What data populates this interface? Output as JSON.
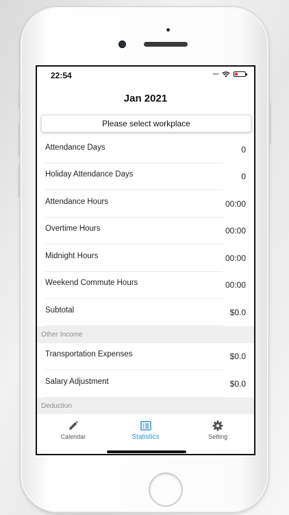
{
  "status_bar": {
    "time": "22:54"
  },
  "header": {
    "title": "Jan 2021"
  },
  "workplace_picker": {
    "label": "Please select workplace"
  },
  "summary": [
    {
      "label": "Attendance Days",
      "value": "0"
    },
    {
      "label": "Holiday Attendance Days",
      "value": "0"
    },
    {
      "label": "Attendance Hours",
      "value": "00:00"
    },
    {
      "label": "Overtime Hours",
      "value": "00:00"
    },
    {
      "label": "Midnight Hours",
      "value": "00:00"
    },
    {
      "label": "Weekend Commute Hours",
      "value": "00:00"
    },
    {
      "label": "Subtotal",
      "value": "$0.0"
    }
  ],
  "other_income": {
    "title": "Other Income",
    "rows": [
      {
        "label": "Transportation Expenses",
        "value": "$0.0"
      },
      {
        "label": "Salary Adjustment",
        "value": "$0.0"
      }
    ]
  },
  "deduction": {
    "title": "Deduction"
  },
  "tabbar": {
    "tabs": [
      {
        "label": "Calendar",
        "icon": "pencil-icon"
      },
      {
        "label": "Statistics",
        "icon": "list-icon",
        "active": true
      },
      {
        "label": "Setting",
        "icon": "gear-icon"
      }
    ]
  },
  "colors": {
    "accent": "#2d95d6",
    "battery_low": "#e53935"
  }
}
